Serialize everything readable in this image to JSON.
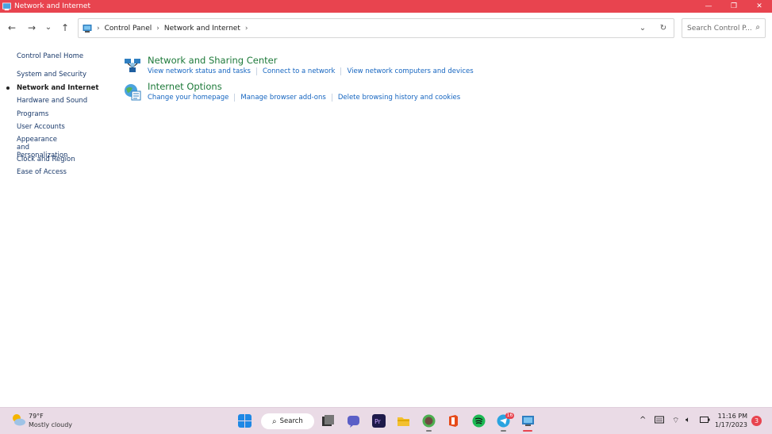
{
  "window": {
    "title": "Network and Internet",
    "controls": [
      "—",
      "❐",
      "✕"
    ]
  },
  "nav": {
    "back": "←",
    "forward": "→",
    "recent": "⌄",
    "up": "↑"
  },
  "address": {
    "crumbs": [
      "Control Panel",
      "Network and Internet"
    ],
    "separator": "›"
  },
  "search": {
    "placeholder": "Search Control P..."
  },
  "sidebar": {
    "items": [
      {
        "label": "Control Panel Home"
      },
      {
        "label": "System and Security"
      },
      {
        "label": "Network and Internet"
      },
      {
        "label": "Hardware and Sound"
      },
      {
        "label": "Programs"
      },
      {
        "label": "User Accounts"
      },
      {
        "label": "Appearance and Personalization"
      },
      {
        "label": "Clock and Region"
      },
      {
        "label": "Ease of Access"
      }
    ]
  },
  "categories": [
    {
      "title": "Network and Sharing Center",
      "links": [
        "View network status and tasks",
        "Connect to a network",
        "View network computers and devices"
      ]
    },
    {
      "title": "Internet Options",
      "links": [
        "Change your homepage",
        "Manage browser add-ons",
        "Delete browsing history and cookies"
      ]
    }
  ],
  "taskbar": {
    "weather_temp": "79°F",
    "weather_condition": "Mostly cloudy",
    "search_label": "Search",
    "telegram_badge": "16",
    "time": "11:16 PM",
    "date": "1/17/2023",
    "notification_count": "3"
  },
  "colors": {
    "titlebar": "#e8444f",
    "link": "#1565c0",
    "category_title": "#1e7a3a",
    "taskbar": "#eadbe6"
  }
}
